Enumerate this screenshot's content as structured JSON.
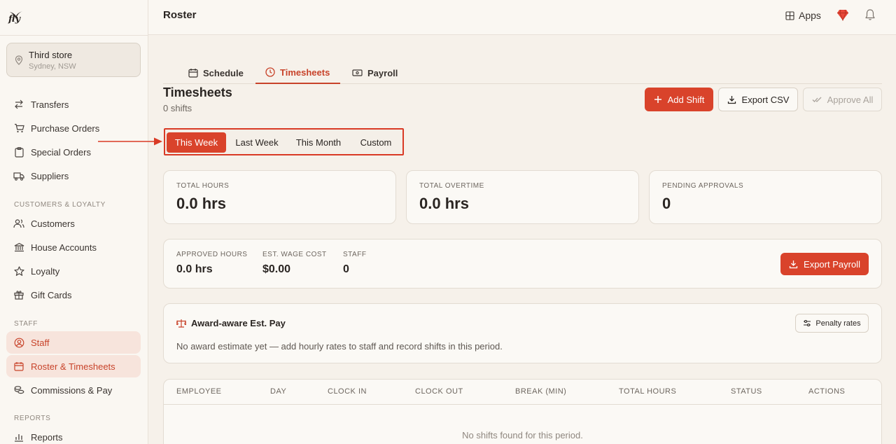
{
  "brand": {
    "logo_text": "fly"
  },
  "store": {
    "name": "Third store",
    "location": "Sydney, NSW"
  },
  "sidebar": {
    "items": [
      {
        "label": "Transfers",
        "icon": "transfer-icon"
      },
      {
        "label": "Purchase Orders",
        "icon": "cart-icon"
      },
      {
        "label": "Special Orders",
        "icon": "clipboard-icon"
      },
      {
        "label": "Suppliers",
        "icon": "truck-icon"
      }
    ],
    "sections": [
      {
        "label": "CUSTOMERS & LOYALTY",
        "items": [
          {
            "label": "Customers",
            "icon": "users-icon"
          },
          {
            "label": "House Accounts",
            "icon": "bank-icon"
          },
          {
            "label": "Loyalty",
            "icon": "star-icon"
          },
          {
            "label": "Gift Cards",
            "icon": "gift-icon"
          }
        ]
      },
      {
        "label": "STAFF",
        "items": [
          {
            "label": "Staff",
            "icon": "user-circle-icon"
          },
          {
            "label": "Roster & Timesheets",
            "icon": "calendar-icon"
          },
          {
            "label": "Commissions & Pay",
            "icon": "coins-icon"
          }
        ]
      },
      {
        "label": "REPORTS",
        "items": [
          {
            "label": "Reports",
            "icon": "chart-icon"
          }
        ]
      }
    ]
  },
  "header": {
    "title": "Roster",
    "apps_label": "Apps"
  },
  "tabs": [
    {
      "label": "Schedule",
      "icon": "calendar-icon"
    },
    {
      "label": "Timesheets",
      "icon": "clock-icon",
      "active": true
    },
    {
      "label": "Payroll",
      "icon": "money-icon"
    }
  ],
  "page": {
    "title": "Timesheets",
    "subtitle": "0 shifts"
  },
  "actions": {
    "add_shift": "Add Shift",
    "export_csv": "Export CSV",
    "approve_all": "Approve All"
  },
  "period": {
    "options": [
      "This Week",
      "Last Week",
      "This Month",
      "Custom"
    ],
    "selected": "This Week"
  },
  "stats": [
    {
      "label": "TOTAL HOURS",
      "value": "0.0 hrs"
    },
    {
      "label": "TOTAL OVERTIME",
      "value": "0.0 hrs"
    },
    {
      "label": "PENDING APPROVALS",
      "value": "0"
    }
  ],
  "summary": {
    "items": [
      {
        "label": "APPROVED HOURS",
        "value": "0.0 hrs"
      },
      {
        "label": "EST. WAGE COST",
        "value": "$0.00"
      },
      {
        "label": "STAFF",
        "value": "0"
      }
    ],
    "export_payroll": "Export Payroll"
  },
  "award": {
    "title": "Award-aware Est. Pay",
    "description": "No award estimate yet — add hourly rates to staff and record shifts in this period.",
    "penalty_button": "Penalty rates"
  },
  "table": {
    "columns": [
      "EMPLOYEE",
      "DAY",
      "CLOCK IN",
      "CLOCK OUT",
      "BREAK (MIN)",
      "TOTAL HOURS",
      "STATUS",
      "ACTIONS"
    ],
    "empty_text": "No shifts found for this period."
  },
  "colors": {
    "accent": "#d9432b",
    "background": "#f6f1ea",
    "card": "#fbf9f5"
  }
}
